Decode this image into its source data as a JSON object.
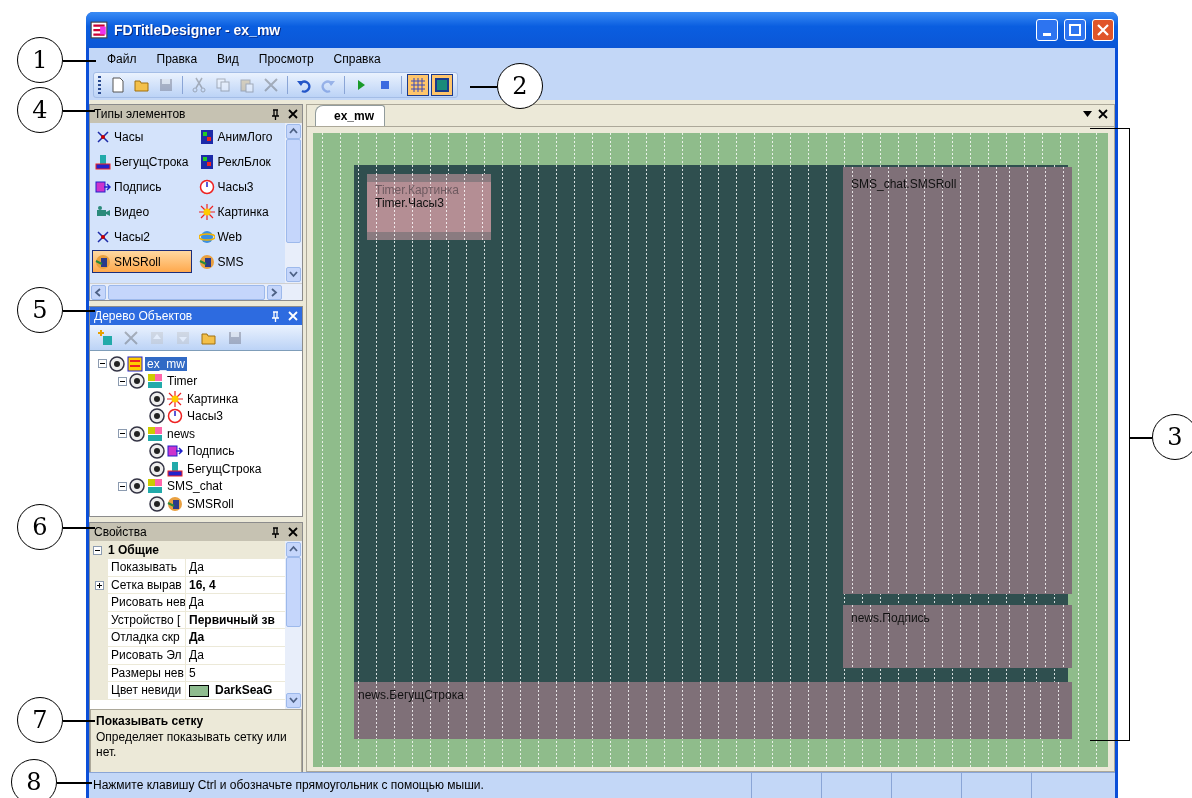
{
  "window": {
    "title": "FDTitleDesigner - ex_mw"
  },
  "menu": [
    {
      "label": "Файл"
    },
    {
      "label": "Правка"
    },
    {
      "label": "Вид"
    },
    {
      "label": "Просмотр"
    },
    {
      "label": "Справка"
    }
  ],
  "toolbar": [
    {
      "kind": "new",
      "disabled": false,
      "selected": false
    },
    {
      "kind": "open",
      "disabled": false,
      "selected": false
    },
    {
      "kind": "save",
      "disabled": true,
      "selected": false
    },
    {
      "kind": "sep"
    },
    {
      "kind": "cut",
      "disabled": true,
      "selected": false
    },
    {
      "kind": "copy",
      "disabled": true,
      "selected": false
    },
    {
      "kind": "paste",
      "disabled": true,
      "selected": false
    },
    {
      "kind": "delete",
      "disabled": true,
      "selected": false
    },
    {
      "kind": "sep"
    },
    {
      "kind": "undo",
      "disabled": false,
      "selected": false
    },
    {
      "kind": "redo",
      "disabled": true,
      "selected": false
    },
    {
      "kind": "sep"
    },
    {
      "kind": "play",
      "disabled": false,
      "selected": false
    },
    {
      "kind": "stop",
      "disabled": false,
      "selected": false
    },
    {
      "kind": "sep"
    },
    {
      "kind": "grid",
      "disabled": false,
      "selected": true
    },
    {
      "kind": "background",
      "disabled": false,
      "selected": true
    }
  ],
  "element_types": {
    "title": "Типы элементов",
    "items": [
      {
        "label": "Часы",
        "kind": "clock",
        "selected": false
      },
      {
        "label": "АнимЛого",
        "kind": "film",
        "selected": false
      },
      {
        "label": "БегущСтрока",
        "kind": "ticker",
        "selected": false
      },
      {
        "label": "РеклБлок",
        "kind": "film",
        "selected": false
      },
      {
        "label": "Подпись",
        "kind": "caption",
        "selected": false
      },
      {
        "label": "Часы3",
        "kind": "dial",
        "selected": false
      },
      {
        "label": "Видео",
        "kind": "camera",
        "selected": false
      },
      {
        "label": "Картинка",
        "kind": "sun",
        "selected": false
      },
      {
        "label": "Часы2",
        "kind": "clock",
        "selected": false
      },
      {
        "label": "Web",
        "kind": "globe",
        "selected": false
      },
      {
        "label": "SMSRoll",
        "kind": "sms",
        "selected": true
      },
      {
        "label": "SMS",
        "kind": "sms",
        "selected": false
      }
    ]
  },
  "object_tree": {
    "title": "Дерево Объектов",
    "toolbar": [
      {
        "kind": "add",
        "disabled": false
      },
      {
        "kind": "delete",
        "disabled": true
      },
      {
        "kind": "up",
        "disabled": true
      },
      {
        "kind": "down",
        "disabled": true
      },
      {
        "kind": "open",
        "disabled": false
      },
      {
        "kind": "save",
        "disabled": true
      }
    ],
    "nodes": [
      {
        "label": "ex_mw",
        "kind": "scene",
        "expanded": true,
        "selected": true,
        "children": [
          {
            "label": "Timer",
            "kind": "group",
            "expanded": true,
            "selected": false,
            "children": [
              {
                "label": "Картинка",
                "kind": "sun",
                "selected": false
              },
              {
                "label": "Часы3",
                "kind": "dial",
                "selected": false
              }
            ]
          },
          {
            "label": "news",
            "kind": "group",
            "expanded": true,
            "selected": false,
            "children": [
              {
                "label": "Подпись",
                "kind": "caption",
                "selected": false
              },
              {
                "label": "БегущСтрока",
                "kind": "ticker",
                "selected": false
              }
            ]
          },
          {
            "label": "SMS_chat",
            "kind": "group",
            "expanded": true,
            "selected": false,
            "children": [
              {
                "label": "SMSRoll",
                "kind": "sms",
                "selected": false
              }
            ]
          }
        ]
      }
    ]
  },
  "properties": {
    "title": "Свойства",
    "category": {
      "label": "1 Общие",
      "expanded": true
    },
    "rows": [
      {
        "name": "Показывать",
        "value": "Да",
        "modified": false,
        "expandable": false
      },
      {
        "name": "Сетка вырав",
        "value": "16, 4",
        "modified": true,
        "expandable": true
      },
      {
        "name": "Рисовать нев",
        "value": "Да",
        "modified": false,
        "expandable": false
      },
      {
        "name": "Устройство [",
        "value": "Первичный зв",
        "modified": true,
        "expandable": false
      },
      {
        "name": "Отладка скр",
        "value": "Да",
        "modified": true,
        "expandable": false
      },
      {
        "name": "Рисовать Эл",
        "value": "Да",
        "modified": false,
        "expandable": false
      },
      {
        "name": "Размеры нев",
        "value": "5",
        "modified": false,
        "expandable": false
      },
      {
        "name": "Цвет невиди",
        "value": "DarkSeaG",
        "modified": true,
        "expandable": false,
        "color": "#8fbc8f"
      }
    ],
    "description": {
      "title": "Показывать сетку",
      "text": "Определяет показывать сетку или нет."
    }
  },
  "document": {
    "tabs": [
      {
        "label": "ex_mw",
        "selected": true
      }
    ],
    "canvas_items": [
      {
        "label": "Timer.Картинка",
        "color": "#8a7b80",
        "faded": true
      },
      {
        "label": "Timer.Часы3",
        "color": "#b48e94",
        "faded": false
      },
      {
        "label": "SMS_chat.SMSRoll",
        "color": "#7f7078",
        "faded": false
      },
      {
        "label": "news.Подпись",
        "color": "#7f7078",
        "faded": false
      },
      {
        "label": "news.БегущСтрока",
        "color": "#7f7078",
        "faded": false
      }
    ]
  },
  "status_bar": {
    "text": "Нажмите клавишу Ctrl и обозначьте прямоугольник с помощью мыши."
  },
  "callouts": [
    "1",
    "2",
    "3",
    "4",
    "5",
    "6",
    "7",
    "8"
  ]
}
